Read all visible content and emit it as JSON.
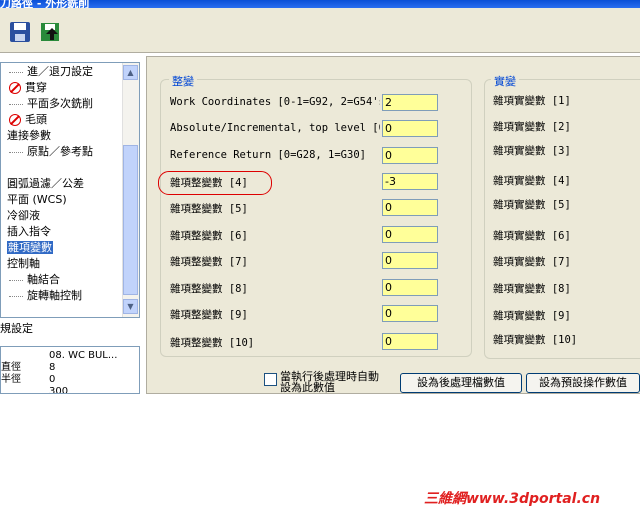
{
  "window": {
    "title": "刀路徑 - 外形銑削"
  },
  "tree": {
    "items": [
      {
        "label": "進／退刀設定"
      },
      {
        "label": "貫穿"
      },
      {
        "label": "平面多次銑削"
      },
      {
        "label": "毛頭"
      },
      {
        "label": "連接參數"
      },
      {
        "label": "原點／參考點"
      },
      {
        "label": "圓弧過濾／公差"
      },
      {
        "label": "平面 (WCS)"
      },
      {
        "label": "冷卻液"
      },
      {
        "label": "插入指令"
      },
      {
        "label": "雜項變數"
      },
      {
        "label": "控制軸"
      },
      {
        "label": "軸結合"
      },
      {
        "label": "旋轉軸控制"
      }
    ]
  },
  "props": {
    "group_label": "規設定",
    "rows": [
      {
        "name": "",
        "value": "08. WC BUL..."
      },
      {
        "name": "直徑",
        "value": "8"
      },
      {
        "name": "半徑",
        "value": "0"
      },
      {
        "name": "",
        "value": "300"
      }
    ]
  },
  "integer_group": {
    "title": "整變",
    "rows": [
      {
        "label": "Work Coordinates [0-1=G92, 2=G54's]",
        "value": "2"
      },
      {
        "label": "Absolute/Incremental, top level [0=",
        "value": "0"
      },
      {
        "label": "Reference Return [0=G28, 1=G30]",
        "value": "0"
      },
      {
        "label": "雜項整變數 [4]",
        "value": "-3"
      },
      {
        "label": "雜項整變數 [5]",
        "value": "0"
      },
      {
        "label": "雜項整變數 [6]",
        "value": "0"
      },
      {
        "label": "雜項整變數 [7]",
        "value": "0"
      },
      {
        "label": "雜項整變數 [8]",
        "value": "0"
      },
      {
        "label": "雜項整變數 [9]",
        "value": "0"
      },
      {
        "label": "雜項整變數 [10]",
        "value": "0"
      }
    ]
  },
  "real_group": {
    "title": "實變",
    "rows": [
      {
        "label": "雜項實變數 [1]"
      },
      {
        "label": "雜項實變數 [2]"
      },
      {
        "label": "雜項實變數 [3]"
      },
      {
        "label": "雜項實變數 [4]"
      },
      {
        "label": "雜項實變數 [5]"
      },
      {
        "label": "雜項實變數 [6]"
      },
      {
        "label": "雜項實變數 [7]"
      },
      {
        "label": "雜項實變數 [8]"
      },
      {
        "label": "雜項實變數 [9]"
      },
      {
        "label": "雜項實變數 [10]"
      }
    ]
  },
  "bottom": {
    "checkbox_line1": "當執行後處理時自動",
    "checkbox_line2": "設為此數值",
    "button_post": "設為後處理檔數值",
    "button_default": "設為預設操作數值"
  },
  "watermark": "三維網www.3dportal.cn",
  "colors": {
    "input_bg": "#ffff99",
    "group_title": "#0046d5",
    "selection": "#316ac5",
    "highlight_oval": "#dd0000"
  }
}
